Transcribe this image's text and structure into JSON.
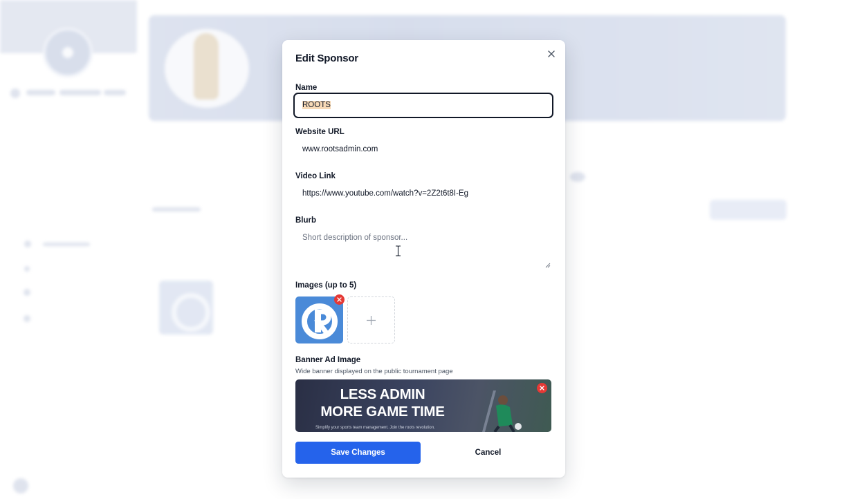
{
  "modal": {
    "title": "Edit Sponsor",
    "close_icon": "close-icon"
  },
  "form": {
    "name": {
      "label": "Name",
      "value": "ROOTS"
    },
    "website": {
      "label": "Website URL",
      "value": "www.rootsadmin.com"
    },
    "video": {
      "label": "Video Link",
      "value": "https://www.youtube.com/watch?v=2Z2t6t8I-Eg"
    },
    "blurb": {
      "label": "Blurb",
      "placeholder": "Short description of sponsor..."
    },
    "images": {
      "label": "Images (up to 5)",
      "remove_icon": "remove-x-icon",
      "add_icon": "plus-icon"
    },
    "banner": {
      "label": "Banner Ad Image",
      "helper": "Wide banner displayed on the public tournament page",
      "line1": "LESS ADMIN",
      "line2": "MORE GAME TIME",
      "small_text": "Simplify your sports team management. Join the roots revolution."
    }
  },
  "actions": {
    "save_label": "Save Changes",
    "cancel_label": "Cancel"
  },
  "colors": {
    "primary": "#2563eb",
    "remove": "#e53935",
    "text": "#111827",
    "logo_tile": "#4a8ad8"
  }
}
